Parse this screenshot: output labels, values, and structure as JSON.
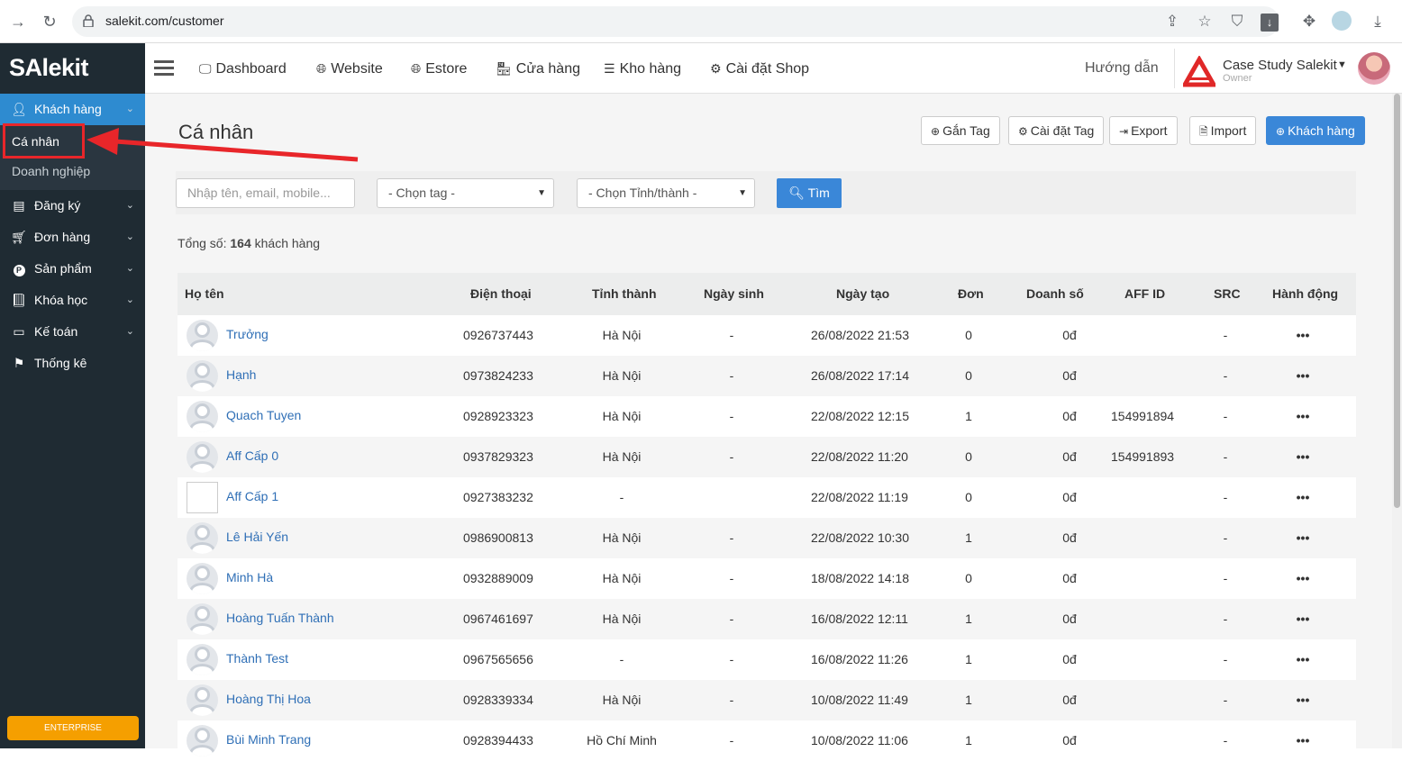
{
  "browser": {
    "url": "salekit.com/customer"
  },
  "sidebar": {
    "logo": "SAlekit",
    "items": [
      {
        "label": "Khách hàng",
        "icon": "user-icon"
      },
      {
        "label": "Đăng ký",
        "icon": "list-icon"
      },
      {
        "label": "Đơn hàng",
        "icon": "cart-icon"
      },
      {
        "label": "Sản phẩm",
        "icon": "product-icon"
      },
      {
        "label": "Khóa học",
        "icon": "book-icon"
      },
      {
        "label": "Kế toán",
        "icon": "card-icon"
      },
      {
        "label": "Thống kê",
        "icon": "flag-icon"
      }
    ],
    "sub_items": [
      "Cá nhân",
      "Doanh nghiệp"
    ],
    "enterprise_label": "ENTERPRISE"
  },
  "topnav": {
    "links": [
      "Dashboard",
      "Website",
      "Estore",
      "Cửa hàng",
      "Kho hàng",
      "Cài đặt Shop"
    ],
    "guide": "Hướng dẫn",
    "shop_name": "Case Study Salekit",
    "shop_role": "Owner"
  },
  "page": {
    "title": "Cá nhân",
    "buttons": {
      "tag": "Gắn Tag",
      "tag_settings": "Cài đặt Tag",
      "export": "Export",
      "import": "Import",
      "add_customer": "Khách hàng"
    },
    "search_placeholder": "Nhập tên, email, mobile...",
    "tag_select": "- Chọn tag -",
    "province_select": "- Chọn Tỉnh/thành -",
    "find_label": "Tìm",
    "total_prefix": "Tổng số:",
    "total_count": "164",
    "total_suffix": "khách hàng"
  },
  "table": {
    "headers": [
      "Họ tên",
      "Điện thoại",
      "Tỉnh thành",
      "Ngày sinh",
      "Ngày tạo",
      "Đơn",
      "Doanh số",
      "AFF ID",
      "SRC",
      "Hành động"
    ],
    "rows": [
      {
        "name": "Trưởng",
        "phone": "0926737443",
        "province": "Hà Nội",
        "birthday": "-",
        "created": "26/08/2022 21:53",
        "orders": "0",
        "revenue": "0đ",
        "aff_id": "",
        "src": "-",
        "action": "•••"
      },
      {
        "name": "Hạnh",
        "phone": "0973824233",
        "province": "Hà Nội",
        "birthday": "-",
        "created": "26/08/2022 17:14",
        "orders": "0",
        "revenue": "0đ",
        "aff_id": "",
        "src": "-",
        "action": "•••"
      },
      {
        "name": "Quach Tuyen",
        "phone": "0928923323",
        "province": "Hà Nội",
        "birthday": "-",
        "created": "22/08/2022 12:15",
        "orders": "1",
        "revenue": "0đ",
        "aff_id": "154991894",
        "src": "-",
        "action": "•••"
      },
      {
        "name": "Aff Cấp 0",
        "phone": "0937829323",
        "province": "Hà Nội",
        "birthday": "-",
        "created": "22/08/2022 11:20",
        "orders": "0",
        "revenue": "0đ",
        "aff_id": "154991893",
        "src": "-",
        "action": "•••"
      },
      {
        "name": "Aff Cấp 1",
        "phone": "0927383232",
        "province": "-",
        "birthday": "",
        "created": "22/08/2022 11:19",
        "orders": "0",
        "revenue": "0đ",
        "aff_id": "",
        "src": "-",
        "action": "•••"
      },
      {
        "name": "Lê Hải Yến",
        "phone": "0986900813",
        "province": "Hà Nội",
        "birthday": "-",
        "created": "22/08/2022 10:30",
        "orders": "1",
        "revenue": "0đ",
        "aff_id": "",
        "src": "-",
        "action": "•••"
      },
      {
        "name": "Minh Hà",
        "phone": "0932889009",
        "province": "Hà Nội",
        "birthday": "-",
        "created": "18/08/2022 14:18",
        "orders": "0",
        "revenue": "0đ",
        "aff_id": "",
        "src": "-",
        "action": "•••"
      },
      {
        "name": "Hoàng Tuấn Thành",
        "phone": "0967461697",
        "province": "Hà Nội",
        "birthday": "-",
        "created": "16/08/2022 12:11",
        "orders": "1",
        "revenue": "0đ",
        "aff_id": "",
        "src": "-",
        "action": "•••"
      },
      {
        "name": "Thành Test",
        "phone": "0967565656",
        "province": "-",
        "birthday": "-",
        "created": "16/08/2022 11:26",
        "orders": "1",
        "revenue": "0đ",
        "aff_id": "",
        "src": "-",
        "action": "•••"
      },
      {
        "name": "Hoàng Thị Hoa",
        "phone": "0928339334",
        "province": "Hà Nội",
        "birthday": "-",
        "created": "10/08/2022 11:49",
        "orders": "1",
        "revenue": "0đ",
        "aff_id": "",
        "src": "-",
        "action": "•••"
      },
      {
        "name": "Bùi Minh Trang",
        "phone": "0928394433",
        "province": "Hồ Chí Minh",
        "birthday": "-",
        "created": "10/08/2022 11:06",
        "orders": "1",
        "revenue": "0đ",
        "aff_id": "",
        "src": "-",
        "action": "•••"
      }
    ]
  },
  "colors": {
    "sidebar_bg": "#1f2b33",
    "accent": "#3a87d8",
    "annotation_red": "#e8262a",
    "enterprise": "#f59f00"
  }
}
